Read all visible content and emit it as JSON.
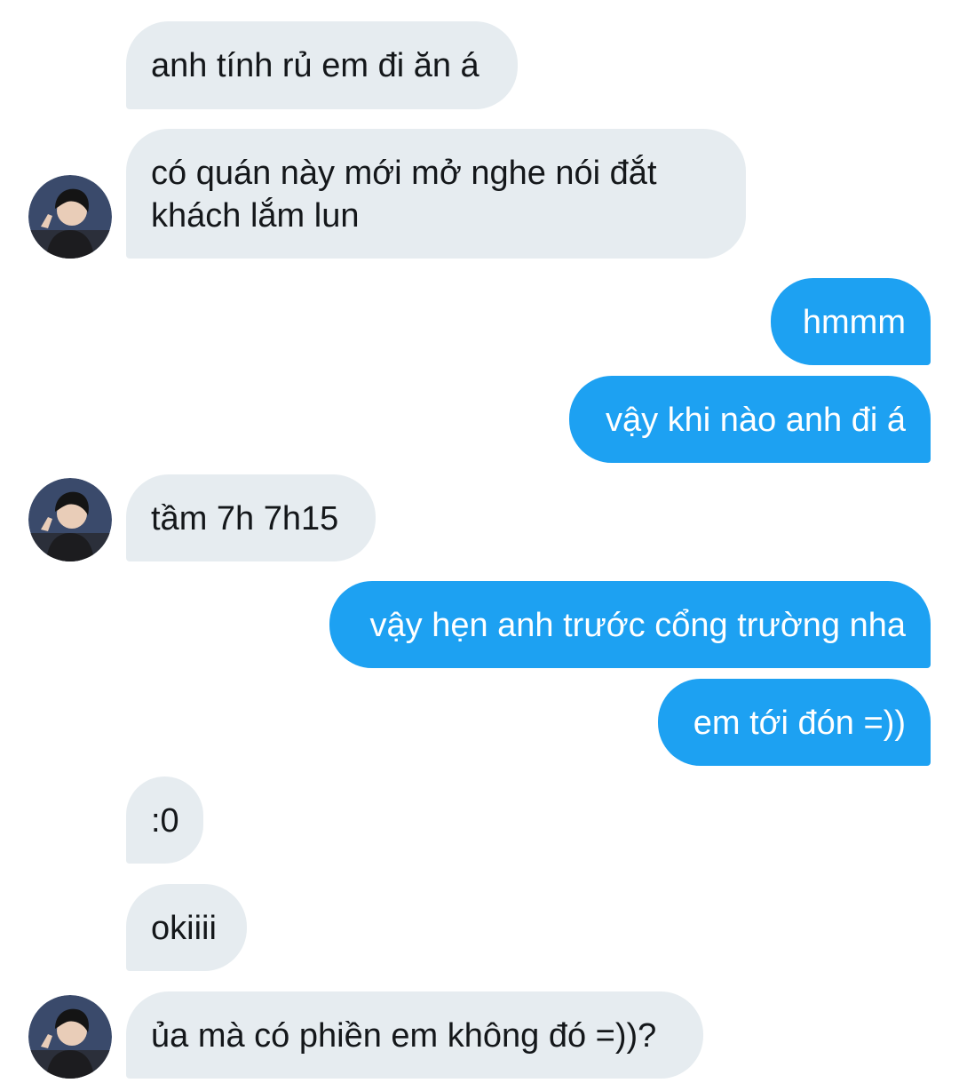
{
  "conversation": {
    "contact_avatar_icon": "user-avatar-icon",
    "colors": {
      "incoming_bubble": "#e6ecf0",
      "outgoing_bubble": "#1da1f2",
      "incoming_text": "#14171a",
      "outgoing_text": "#ffffff"
    },
    "messages": [
      {
        "sender": "contact",
        "text": "anh tính rủ em đi ăn á"
      },
      {
        "sender": "contact",
        "text": "có quán này mới mở nghe nói đắt\nkhách lắm lun"
      },
      {
        "sender": "me",
        "text": "hmmm"
      },
      {
        "sender": "me",
        "text": "vậy khi nào anh đi á"
      },
      {
        "sender": "contact",
        "text": "tầm 7h 7h15"
      },
      {
        "sender": "me",
        "text": "vậy hẹn anh trước cổng trường nha"
      },
      {
        "sender": "me",
        "text": "em tới đón =))"
      },
      {
        "sender": "contact",
        "text": ":0"
      },
      {
        "sender": "contact",
        "text": "okiiii"
      },
      {
        "sender": "contact",
        "text": "ủa mà có phiền em không đó =))?"
      }
    ]
  }
}
